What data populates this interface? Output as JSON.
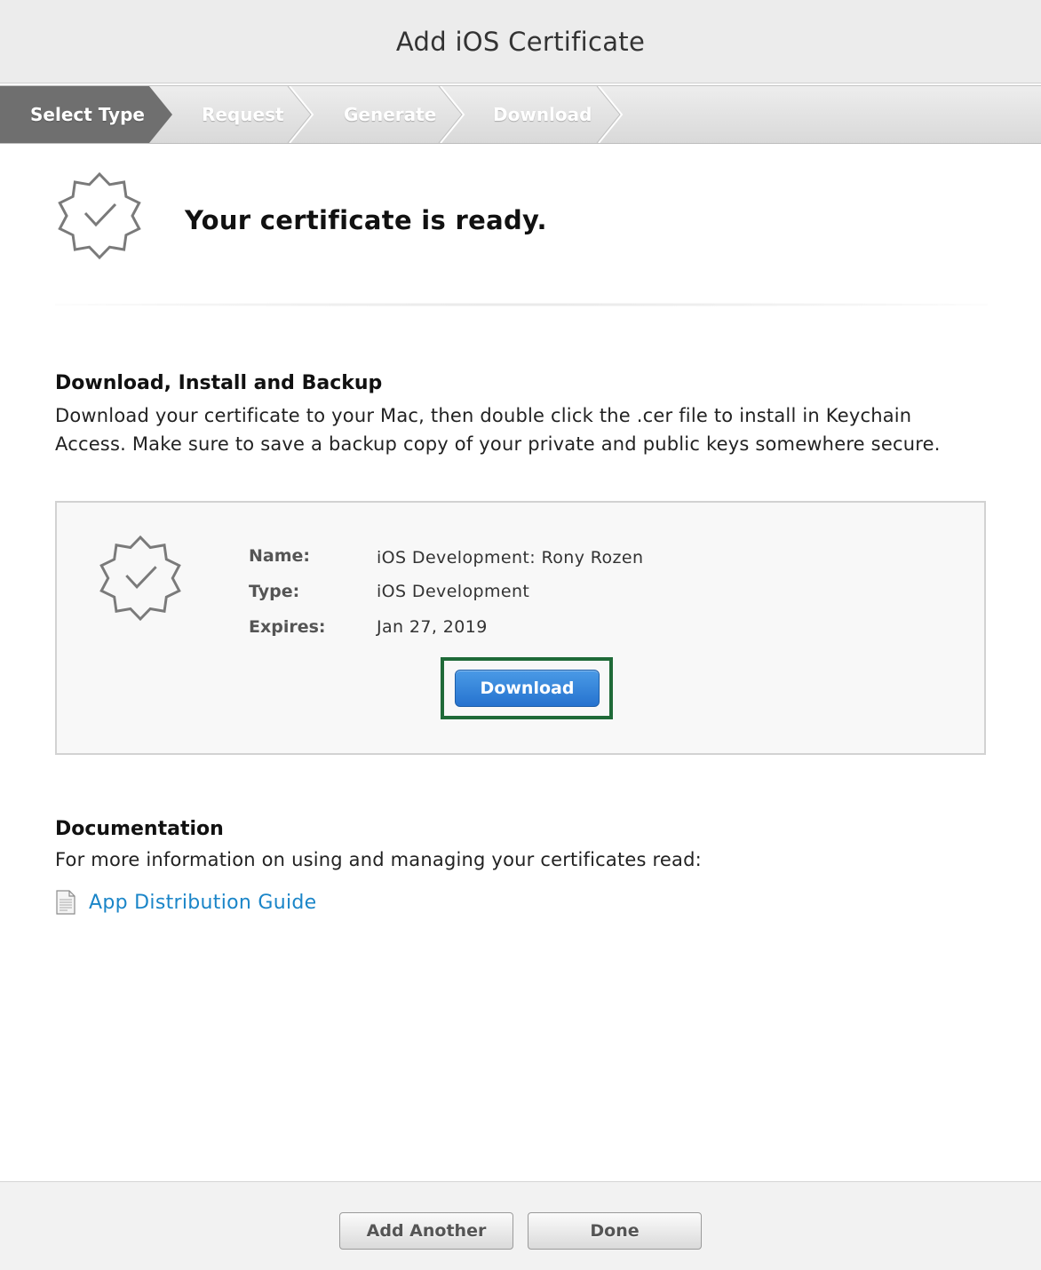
{
  "title": "Add iOS Certificate",
  "steps": [
    {
      "label": "Select Type",
      "active": true
    },
    {
      "label": "Request",
      "active": false
    },
    {
      "label": "Generate",
      "active": false
    },
    {
      "label": "Download",
      "active": false
    }
  ],
  "header": {
    "icon": "certificate-badge-icon",
    "title": "Your certificate is ready."
  },
  "install": {
    "heading": "Download, Install and Backup",
    "body_line1": "Download your certificate to your Mac, then double click the .cer file to install in Keychain",
    "body_line2": "Access. Make sure to save a backup copy of your private and public keys somewhere secure."
  },
  "certificate": {
    "icon": "certificate-badge-icon",
    "name_label": "Name:",
    "name_value": "iOS Development: Rony Rozen",
    "type_label": "Type:",
    "type_value": "iOS Development",
    "expires_label": "Expires:",
    "expires_value": "Jan 27, 2019",
    "download_label": "Download",
    "highlight_color": "#1f6a38",
    "button_color": "#2f7fd8"
  },
  "documentation": {
    "heading": "Documentation",
    "body": "For more information on using and managing your certificates read:",
    "link_icon": "document-icon",
    "link_label": "App Distribution Guide",
    "link_color": "#1a85c8"
  },
  "footer": {
    "add_another_label": "Add Another",
    "done_label": "Done"
  }
}
